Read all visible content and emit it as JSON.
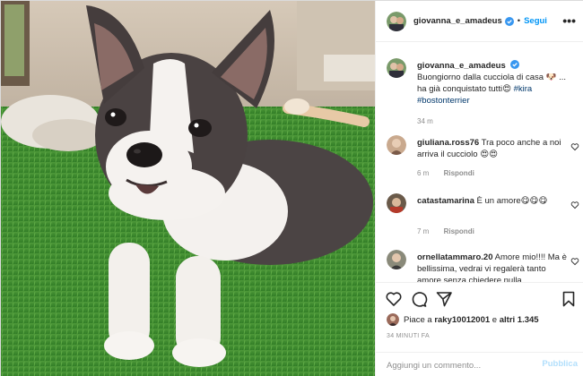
{
  "post": {
    "username": "giovanna_e_amadeus",
    "follow_label": "Segui",
    "separator": "•",
    "more_label": "•••",
    "verified_icon": "verified-badge-icon",
    "photo_description_icon": "dog-photo"
  },
  "caption": {
    "username": "giovanna_e_amadeus",
    "text": "Buongiorno dalla cucciola di casa 🐶 ... ha già conquistato tutti😍",
    "hashtags": [
      "#kira",
      "#bostonterrier"
    ],
    "age": "34 m"
  },
  "comments": [
    {
      "username": "giuliana.ross76",
      "text": "Tra poco anche a noi arriva il cucciolo 😍😍",
      "age": "6 m",
      "reply_label": "Rispondi"
    },
    {
      "username": "catastamarina",
      "text": "È un amore😋😋😋",
      "age": "7 m",
      "reply_label": "Rispondi"
    },
    {
      "username": "ornellatammaro.20",
      "text": "Amore mio!!!! Ma è bellissima, vedrai vi regalerà tanto amore senza chiedere nulla"
    }
  ],
  "likes": {
    "prefix": "Piace a",
    "user": "raky10012001",
    "conjunction": "e",
    "others": "altri 1.345"
  },
  "timestamp": "34 MINUTI FA",
  "add_comment": {
    "placeholder": "Aggiungi un commento...",
    "publish_label": "Pubblica"
  },
  "colors": {
    "accent": "#0095f6",
    "publish_disabled": "#b2dffc",
    "hashtag": "#00376b",
    "muted": "#8e8e8e"
  }
}
